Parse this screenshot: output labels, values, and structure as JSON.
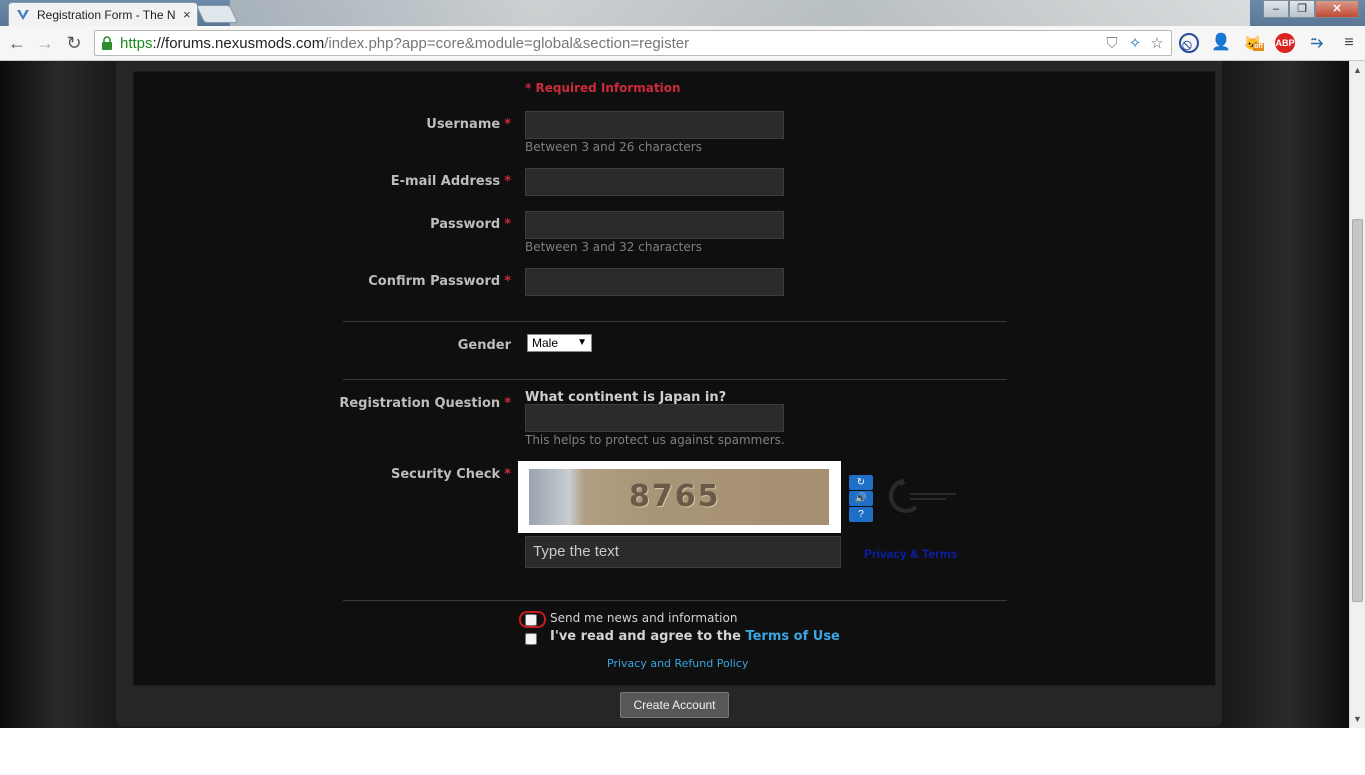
{
  "browser": {
    "tab_title": "Registration Form - The N",
    "tab_close": "×",
    "url_scheme": "https",
    "url_host": "://forums.nexusmods.com",
    "url_path": "/index.php?app=core&module=global&section=register",
    "ext_abp": "ABP",
    "ext_off": "off"
  },
  "form": {
    "required_info": "* Required Information",
    "required_star": "*",
    "username_label": "Username",
    "username_hint": "Between 3 and 26 characters",
    "email_label": "E-mail Address",
    "password_label": "Password",
    "password_hint": "Between 3 and 32 characters",
    "confirm_label": "Confirm Password",
    "gender_label": "Gender",
    "gender_value": "Male",
    "question_label": "Registration Question",
    "question_text": "What continent is Japan in?",
    "question_hint": "This helps to protect us against spammers.",
    "security_label": "Security Check",
    "captcha_text": "8765",
    "captcha_placeholder": "Type the text",
    "privacy_terms": "Privacy & Terms",
    "news_label": "Send me news and information",
    "agree_prefix": "I've read and agree to the ",
    "agree_link": "Terms of Use",
    "refund_link": "Privacy and Refund Policy",
    "create_button": "Create Account"
  },
  "colors": {
    "required_red": "#cc2a3b",
    "link_blue": "#3aa5e0",
    "panel_bg": "#0f0f0f"
  }
}
